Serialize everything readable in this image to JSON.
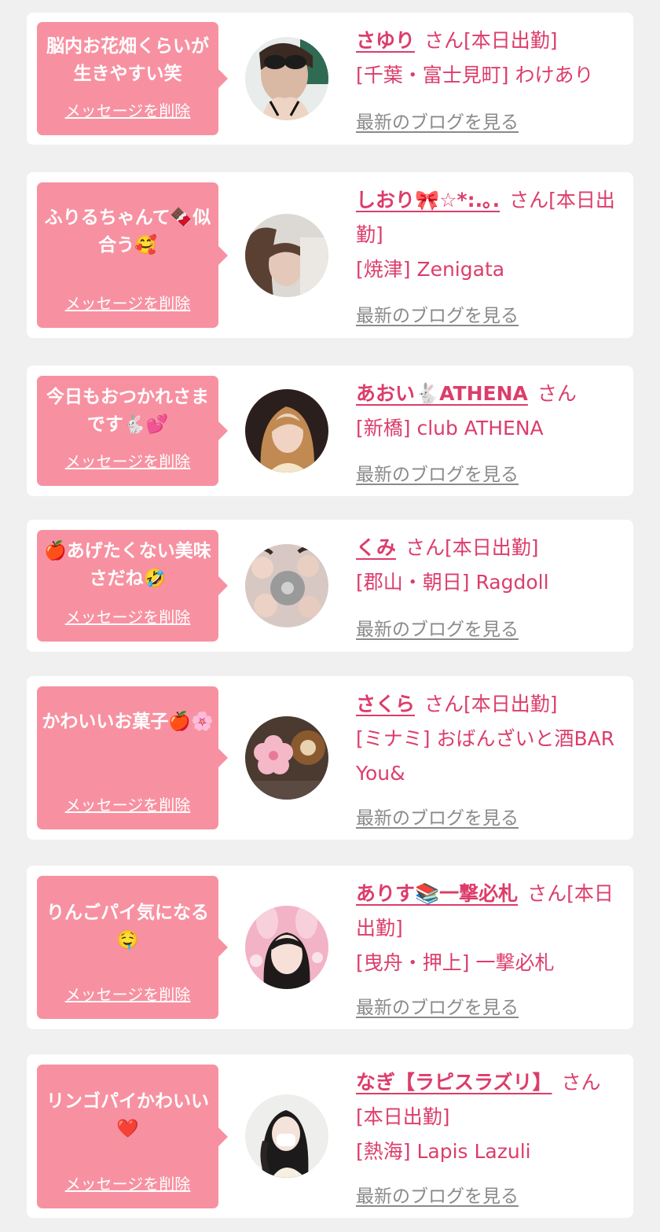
{
  "colors": {
    "page_bg": "#f0f0f0",
    "card_bg": "#ffffff",
    "bubble_bg": "#f791a1",
    "accent_text": "#dc3d6b",
    "link_gray": "#8a8a8a"
  },
  "messages": [
    {
      "bubble": "脳内お花畑くらいが生きやすい笑",
      "delete_label": "メッセージを削除",
      "name": "さゆり",
      "name_suffix": "さん",
      "status": "[本日出勤]",
      "location_shop": "[千葉・富士見町] わけあり",
      "blog_label": "最新のブログを見る",
      "avatar_icon": "avatar-sunglasses-woman"
    },
    {
      "bubble": "ふりるちゃんて🍫似合う🥰",
      "delete_label": "メッセージを削除",
      "name": "しおり🎀☆*:.｡.",
      "name_suffix": "さん",
      "status": "[本日出勤]",
      "location_shop": "[焼津] Zenigata",
      "blog_label": "最新のブログを見る",
      "avatar_icon": "avatar-woman-soft-focus"
    },
    {
      "bubble": "今日もおつかれさまです🐇💕",
      "delete_label": "メッセージを削除",
      "name": "あおい🐇ATHENA",
      "name_suffix": "さん",
      "status": "",
      "location_shop": "[新橋] club ATHENA",
      "blog_label": "最新のブログを見る",
      "avatar_icon": "avatar-woman-blonde"
    },
    {
      "bubble": "🍎あげたくない美味さだね🤣",
      "delete_label": "メッセージを削除",
      "name": "くみ",
      "name_suffix": "さん",
      "status": "[本日出勤]",
      "location_shop": "[郡山・朝日] Ragdoll",
      "blog_label": "最新のブログを見る",
      "avatar_icon": "avatar-group-collage"
    },
    {
      "bubble": "かわいいお菓子🍎🌸",
      "delete_label": "メッセージを削除",
      "name": "さくら",
      "name_suffix": "さん",
      "status": "[本日出勤]",
      "location_shop": "[ミナミ] おばんざいと酒BAR You&",
      "blog_label": "最新のブログを見る",
      "avatar_icon": "avatar-flower-plush"
    },
    {
      "bubble": "りんごパイ気になる🤤",
      "delete_label": "メッセージを削除",
      "name": "ありす📚一撃必札",
      "name_suffix": "さん",
      "status": "[本日出勤]",
      "location_shop": "[曳舟・押上] 一撃必札",
      "blog_label": "最新のブログを見る",
      "avatar_icon": "avatar-bunny-ears-woman"
    },
    {
      "bubble": "リンゴパイかわいい❤️",
      "delete_label": "メッセージを削除",
      "name": "なぎ【ラピスラズリ】",
      "name_suffix": "さん",
      "status": "[本日出勤]",
      "location_shop": "[熱海] Lapis Lazuli",
      "blog_label": "最新のブログを見る",
      "avatar_icon": "avatar-woman-braid-mask"
    }
  ]
}
